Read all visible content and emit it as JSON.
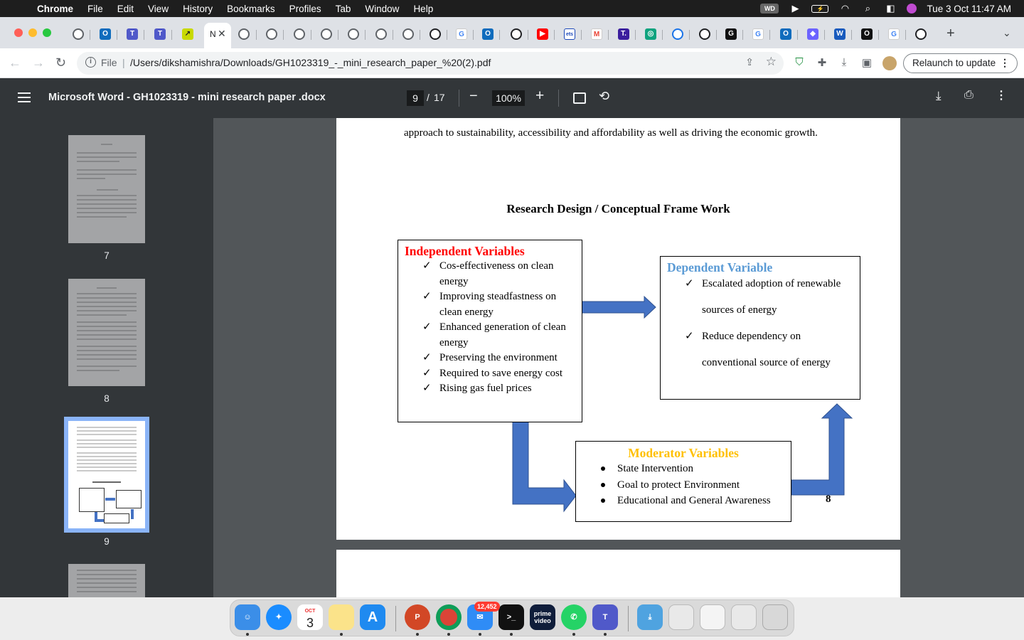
{
  "menubar": {
    "app": "Chrome",
    "menus": [
      "File",
      "Edit",
      "View",
      "History",
      "Bookmarks",
      "Profiles",
      "Tab",
      "Window",
      "Help"
    ],
    "clock": "Tue 3 Oct  11:47 AM"
  },
  "tabs": {
    "active_title": "N",
    "new_tab": "+"
  },
  "address": {
    "scheme": "File",
    "url": "/Users/dikshamishra/Downloads/GH1023319_-_mini_research_paper_%20(2).pdf",
    "relaunch": "Relaunch to update"
  },
  "pdf": {
    "title": "Microsoft Word - GH1023319 - mini research paper .docx",
    "page_current": "9",
    "page_sep": "/",
    "page_total": "17",
    "zoom": "100%"
  },
  "sidebar": {
    "thumbs": [
      {
        "label": "7"
      },
      {
        "label": "8"
      },
      {
        "label": "9"
      }
    ]
  },
  "document": {
    "paragraph": "approach to sustainability, accessibility and affordability    as well as driving the economic growth.",
    "framework_title": "Research Design / Conceptual Frame Work",
    "independent": {
      "title": "Independent Variables",
      "title_color": "#ff0000",
      "items": [
        "Cos-effectiveness on clean energy",
        "Improving steadfastness on clean energy",
        "Enhanced generation of clean energy",
        "Preserving the environment",
        "Required to save energy cost",
        "Rising gas fuel prices"
      ]
    },
    "dependent": {
      "title": "Dependent Variable",
      "title_color": "#5b9bd5",
      "items": [
        "Escalated adoption of renewable sources of energy",
        "Reduce dependency on conventional source of energy"
      ]
    },
    "moderator": {
      "title": "Moderator Variables",
      "title_color": "#ffc000",
      "items": [
        "State Intervention",
        "Goal to protect Environment",
        "Educational and General Awareness"
      ]
    },
    "page_number": "8",
    "check_mark": "✓",
    "arrow_color": "#4472c4"
  },
  "dock": {
    "calendar_month": "OCT",
    "calendar_day": "3",
    "mail_badge": "12,452",
    "prime_label": "prime video"
  }
}
